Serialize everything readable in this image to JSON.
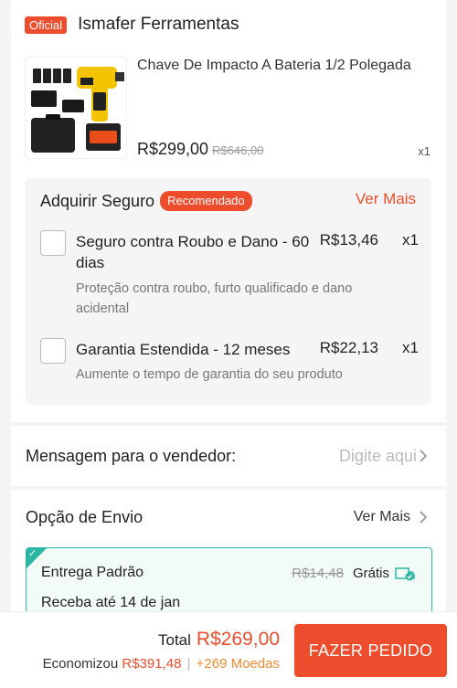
{
  "shop": {
    "badge": "Oficial",
    "name": "Ismafer Ferramentas"
  },
  "product": {
    "title": "Chave De Impacto A Bateria 1/2 Polegada",
    "price": "R$299,00",
    "original_price": "R$646,00",
    "quantity": "x1"
  },
  "insurance": {
    "title": "Adquirir Seguro",
    "badge": "Recomendado",
    "see_more": "Ver Mais",
    "items": [
      {
        "name": "Seguro contra Roubo e Dano - 60 dias",
        "price": "R$13,46",
        "qty": "x1",
        "description": "Proteção contra roubo, furto qualificado e dano acidental"
      },
      {
        "name": "Garantia Estendida - 12 meses",
        "price": "R$22,13",
        "qty": "x1",
        "description": "Aumente o tempo de garantia do seu produto"
      }
    ]
  },
  "message": {
    "label": "Mensagem para o vendedor:",
    "placeholder": "Digite aqui"
  },
  "shipping": {
    "label": "Opção de Envio",
    "see_more": "Ver Mais",
    "option_name": "Entrega Padrão",
    "original_fee": "R$14,48",
    "fee": "Grátis",
    "delivery": "Receba até 14 de jan"
  },
  "footer": {
    "total_label": "Total",
    "total_value": "R$269,00",
    "savings_label": "Economizou",
    "savings_value": "R$391,48",
    "separator": "|",
    "coins": "+269 Moedas",
    "order_button": "FAZER PEDIDO"
  },
  "colors": {
    "accent": "#ee4d2d",
    "shipping_border": "#2bb5a4"
  }
}
